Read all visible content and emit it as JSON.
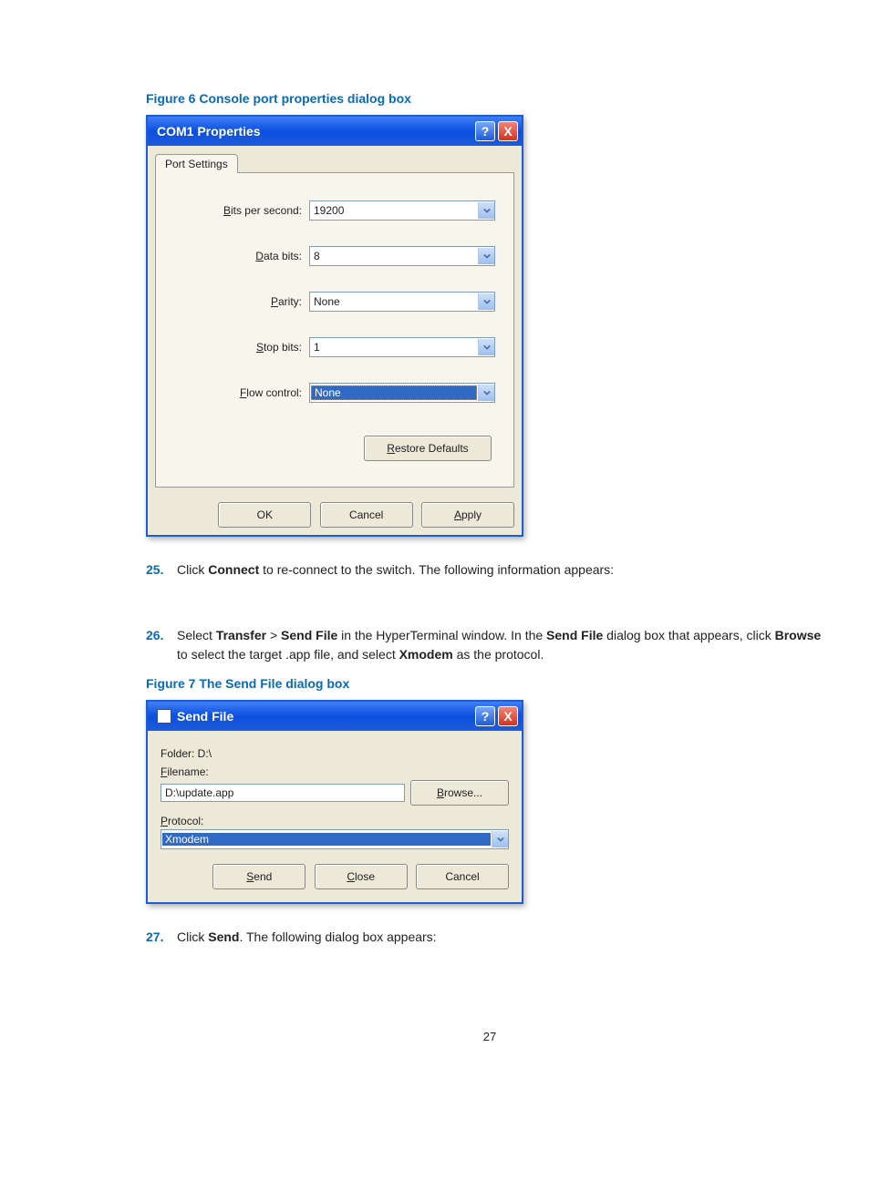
{
  "figure1": {
    "caption": "Figure 6 Console port properties dialog box"
  },
  "dialog1": {
    "title": "COM1 Properties",
    "helpGlyph": "?",
    "closeGlyph": "X",
    "tab": "Port Settings",
    "fields": {
      "bps": {
        "label_pre": "B",
        "label_rest": "its per second:",
        "value": "19200"
      },
      "databits": {
        "label_pre": "D",
        "label_rest": "ata bits:",
        "value": "8"
      },
      "parity": {
        "label_pre": "P",
        "label_rest": "arity:",
        "value": "None"
      },
      "stopbits": {
        "label_pre": "S",
        "label_rest": "top bits:",
        "value": "1"
      },
      "flow": {
        "label_pre": "F",
        "label_rest": "low control:",
        "value": "None"
      }
    },
    "restore": {
      "pre": "R",
      "rest": "estore Defaults"
    },
    "ok": "OK",
    "cancel": "Cancel",
    "apply": {
      "pre": "A",
      "rest": "pply"
    }
  },
  "steps": {
    "s25": {
      "num": "25.",
      "t1": "Click ",
      "b1": "Connect",
      "t2": " to re-connect to the switch. The following information appears:"
    },
    "s26": {
      "num": "26.",
      "t1": "Select ",
      "b1": "Transfer",
      "t2": " > ",
      "b2": "Send File",
      "t3": " in the HyperTerminal window. In the ",
      "b3": "Send File",
      "t4": " dialog box that appears, click ",
      "b4": "Browse",
      "t5": " to select the target .app file, and select ",
      "b5": "Xmodem",
      "t6": " as the protocol."
    },
    "s27": {
      "num": "27.",
      "t1": "Click ",
      "b1": "Send",
      "t2": ". The following dialog box appears:"
    }
  },
  "figure2": {
    "caption": "Figure 7 The Send File dialog box"
  },
  "dialog2": {
    "title": "Send File",
    "helpGlyph": "?",
    "closeGlyph": "X",
    "folder": "Folder: D:\\",
    "filenameLabel": {
      "pre": "F",
      "rest": "ilename:"
    },
    "filenameValue": "D:\\update.app",
    "browse": {
      "pre": "B",
      "rest": "rowse..."
    },
    "protocolLabel": {
      "pre": "P",
      "rest": "rotocol:"
    },
    "protocolValue": "Xmodem",
    "send": {
      "pre": "S",
      "rest": "end"
    },
    "close": {
      "pre": "C",
      "rest": "lose"
    },
    "cancel": "Cancel"
  },
  "pageNumber": "27"
}
